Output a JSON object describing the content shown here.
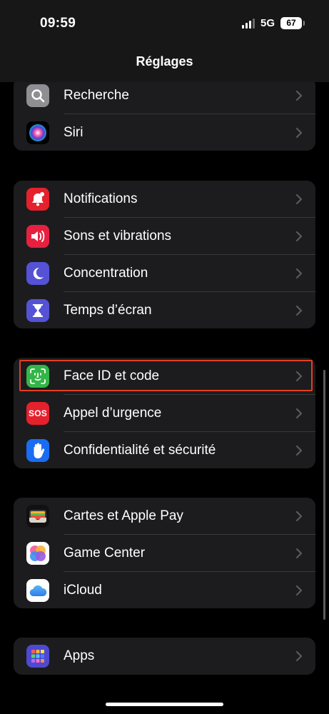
{
  "status_bar": {
    "time": "09:59",
    "network": "5G",
    "battery": "67"
  },
  "nav": {
    "title": "Réglages"
  },
  "groups": [
    {
      "items": [
        {
          "label": "Recherche",
          "icon": "search-icon"
        },
        {
          "label": "Siri",
          "icon": "siri-icon"
        }
      ]
    },
    {
      "items": [
        {
          "label": "Notifications",
          "icon": "bell-icon"
        },
        {
          "label": "Sons et vibrations",
          "icon": "speaker-icon"
        },
        {
          "label": "Concentration",
          "icon": "moon-icon"
        },
        {
          "label": "Temps d’écran",
          "icon": "hourglass-icon"
        }
      ]
    },
    {
      "items": [
        {
          "label": "Face ID et code",
          "icon": "face-id-icon"
        },
        {
          "label": "Appel d’urgence",
          "icon": "sos-icon",
          "icon_text": "SOS"
        },
        {
          "label": "Confidentialité et sécurité",
          "icon": "hand-icon"
        }
      ]
    },
    {
      "items": [
        {
          "label": "Cartes et Apple Pay",
          "icon": "wallet-icon"
        },
        {
          "label": "Game Center",
          "icon": "game-center-icon"
        },
        {
          "label": "iCloud",
          "icon": "icloud-icon"
        }
      ]
    },
    {
      "items": [
        {
          "label": "Apps",
          "icon": "apps-grid-icon"
        }
      ]
    }
  ],
  "highlighted_item": "Face ID et code",
  "colors": {
    "background": "#000000",
    "cell": "#1c1c1e",
    "highlight": "#e3401f",
    "notifications": "#e5212d",
    "sounds": "#e5213f",
    "focus": "#5552d6",
    "screen_time": "#5552d6",
    "face_id": "#34b548",
    "sos": "#e5212d",
    "privacy": "#1a6cf3",
    "apps": "#4e49d1"
  }
}
